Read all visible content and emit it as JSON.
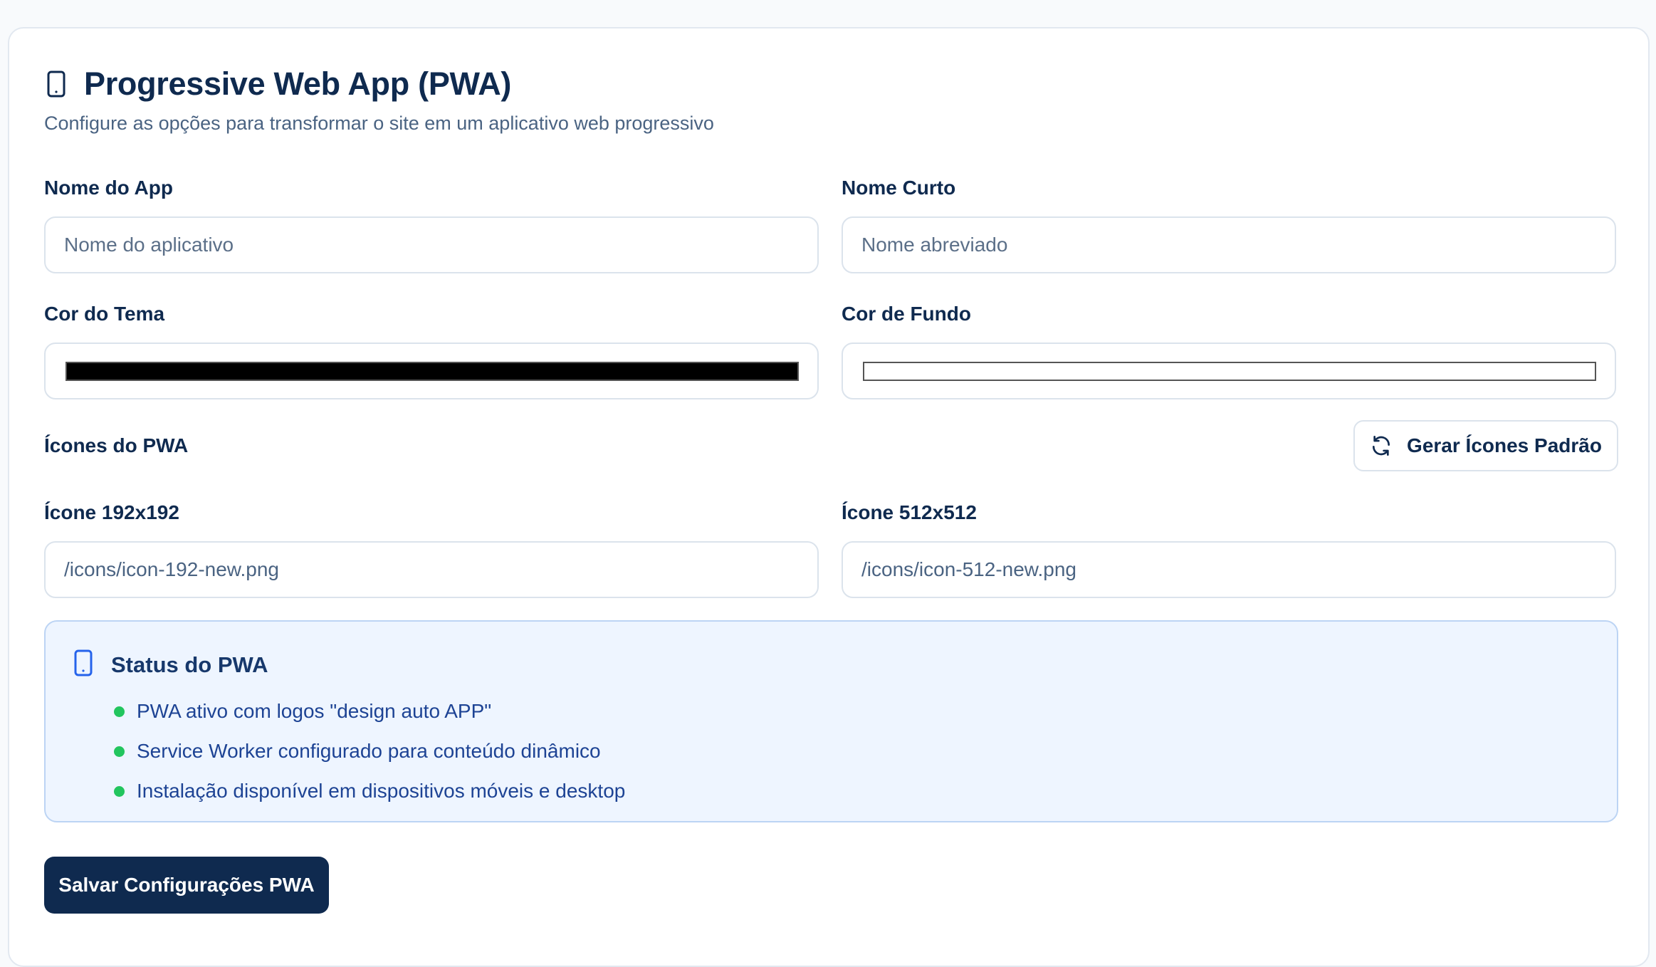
{
  "header": {
    "title": "Progressive Web App (PWA)",
    "subtitle": "Configure as opções para transformar o site em um aplicativo web progressivo",
    "icon": "smartphone-icon"
  },
  "fields": {
    "app_name": {
      "label": "Nome do App",
      "value": "",
      "placeholder": "Nome do aplicativo"
    },
    "short_name": {
      "label": "Nome Curto",
      "value": "",
      "placeholder": "Nome abreviado"
    },
    "theme_color": {
      "label": "Cor do Tema",
      "value": "#000000"
    },
    "background_color": {
      "label": "Cor de Fundo",
      "value": "#ffffff"
    }
  },
  "icons_section": {
    "label": "Ícones do PWA",
    "generate_button": "Gerar Ícones Padrão",
    "generate_icon": "refresh-icon",
    "icon_192": {
      "label": "Ícone 192x192",
      "value": "/icons/icon-192-new.png"
    },
    "icon_512": {
      "label": "Ícone 512x512",
      "value": "/icons/icon-512-new.png"
    }
  },
  "status": {
    "title": "Status do PWA",
    "icon": "smartphone-icon",
    "dot_color": "#22c55e",
    "items": [
      "PWA ativo com logos \"design auto APP\"",
      "Service Worker configurado para conteúdo dinâmico",
      "Instalação disponível em dispositivos móveis e desktop"
    ]
  },
  "save_button": "Salvar Configurações PWA",
  "colors": {
    "primary": "#0f2a4f",
    "status_bg": "#eef5ff",
    "status_border": "#bcd4f4"
  }
}
